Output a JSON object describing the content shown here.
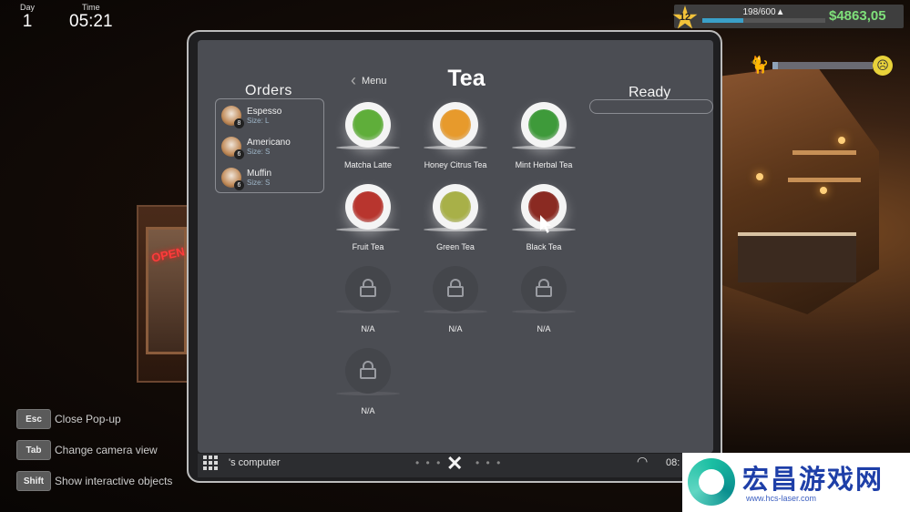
{
  "hud": {
    "day_label": "Day",
    "day_value": "1",
    "time_label": "Time",
    "time_value": "05:21",
    "level": "12",
    "xp_text": "198/600▲",
    "xp_fraction": 0.33,
    "money": "$4863,05",
    "mood_fraction": 0.05
  },
  "hints": [
    {
      "key": "Esc",
      "label": "Close Pop-up"
    },
    {
      "key": "Tab",
      "label": "Change camera view"
    },
    {
      "key": "Shift",
      "label": "Show interactive objects"
    }
  ],
  "orders": {
    "title": "Orders",
    "items": [
      {
        "name": "Espesso",
        "size": "Size: L",
        "badge": "8"
      },
      {
        "name": "Americano",
        "size": "Size: S",
        "badge": "6"
      },
      {
        "name": "Muffin",
        "size": "Size: S",
        "badge": "6"
      }
    ]
  },
  "menu": {
    "back_label": "Menu",
    "category_title": "Tea",
    "items": [
      {
        "label": "Matcha Latte",
        "color": "#5fae3a"
      },
      {
        "label": "Honey Citrus Tea",
        "color": "#e79a2c"
      },
      {
        "label": "Mint Herbal Tea",
        "color": "#3e9a3a"
      },
      {
        "label": "Fruit Tea",
        "color": "#b8352e"
      },
      {
        "label": "Green Tea",
        "color": "#a8b048"
      },
      {
        "label": "Black Tea",
        "color": "#8a2a22"
      },
      {
        "label": "N/A"
      },
      {
        "label": "N/A"
      },
      {
        "label": "N/A"
      },
      {
        "label": "N/A"
      }
    ]
  },
  "ready": {
    "title": "Ready"
  },
  "taskbar": {
    "label": "'s computer",
    "dots": "• • •",
    "close_glyph": "✕",
    "clock": "08:"
  },
  "watermark": {
    "title": "宏昌游戏网",
    "url": "www.hcs-laser.com"
  }
}
